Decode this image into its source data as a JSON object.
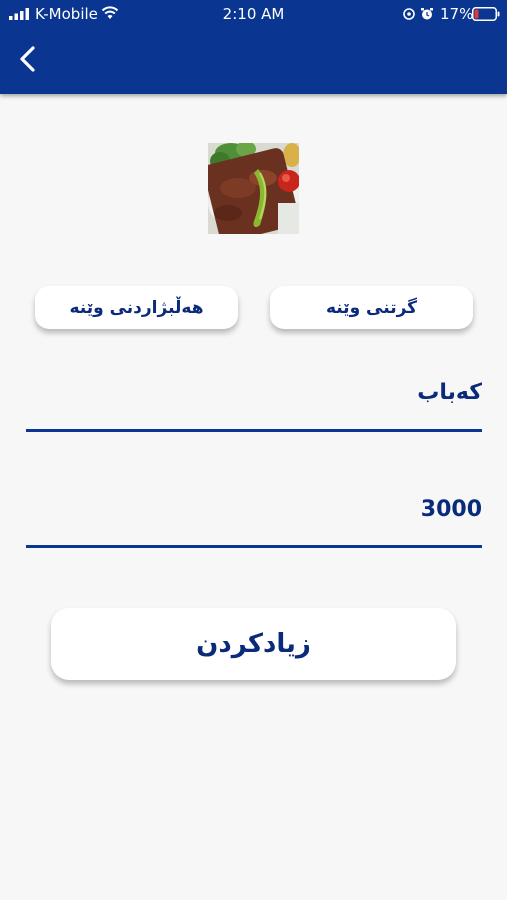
{
  "status_bar": {
    "carrier": "K-Mobile",
    "time": "2:10 AM",
    "battery": "17%"
  },
  "header": {
    "back_icon": "chevron-left-icon"
  },
  "photo": {
    "subject": "kebab dish thumbnail"
  },
  "buttons": {
    "choose_image": "هەڵبژاردنی وێنە",
    "take_image": "گرتنی وێنە",
    "add": "زیادکردن"
  },
  "form": {
    "name_value": "کەباب",
    "price_value": "3000"
  },
  "colors": {
    "primary": "#0a3591",
    "text": "#0a2a7a",
    "background": "#f7f7f8",
    "battery_low": "#e53935"
  }
}
